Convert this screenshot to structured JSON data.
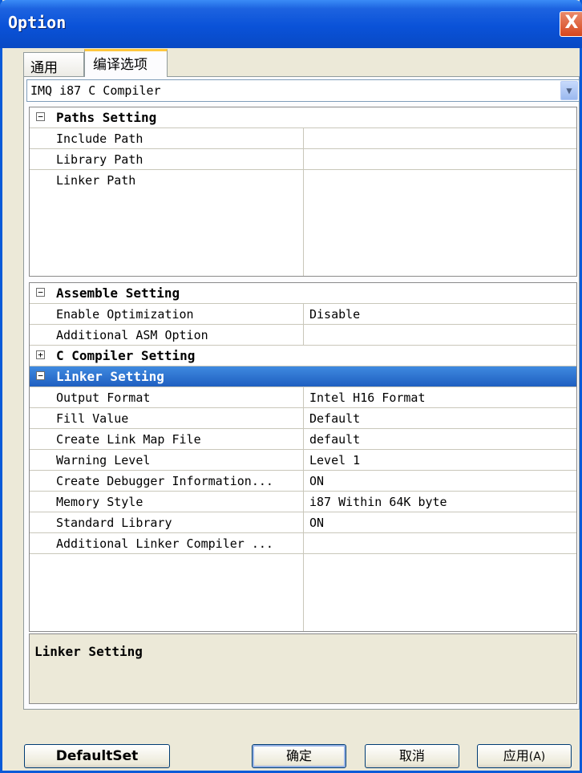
{
  "window": {
    "title": "Option",
    "close": "X"
  },
  "tabs": [
    {
      "label": "通用"
    },
    {
      "label": "编译选项"
    }
  ],
  "compiler": {
    "selected": "IMQ i87 C Compiler",
    "arrow": "▼"
  },
  "paths": {
    "header": "Paths Setting",
    "toggle": "−",
    "rows": [
      {
        "key": "Include Path",
        "value": ""
      },
      {
        "key": "Library Path",
        "value": ""
      },
      {
        "key": "Linker Path",
        "value": ""
      }
    ]
  },
  "assemble": {
    "header": "Assemble Setting",
    "toggle": "−",
    "rows": [
      {
        "key": "Enable Optimization",
        "value": "Disable"
      },
      {
        "key": "Additional ASM Option",
        "value": ""
      }
    ]
  },
  "ccompiler": {
    "header": "C Compiler Setting",
    "toggle": "+"
  },
  "linker": {
    "header": "Linker Setting",
    "toggle": "−",
    "rows": [
      {
        "key": "Output Format",
        "value": "Intel H16 Format"
      },
      {
        "key": "Fill Value",
        "value": "Default"
      },
      {
        "key": "Create Link Map File",
        "value": "default"
      },
      {
        "key": "Warning Level",
        "value": "Level 1"
      },
      {
        "key": "Create Debugger Information...",
        "value": "ON"
      },
      {
        "key": "Memory Style",
        "value": "i87 Within 64K byte"
      },
      {
        "key": "Standard Library",
        "value": "ON"
      },
      {
        "key": "Additional Linker Compiler ...",
        "value": ""
      }
    ]
  },
  "description": {
    "title": "Linker Setting"
  },
  "buttons": {
    "default": "DefaultSet",
    "ok": "确定",
    "cancel": "取消",
    "apply": "应用",
    "apply_key": "(A)"
  }
}
